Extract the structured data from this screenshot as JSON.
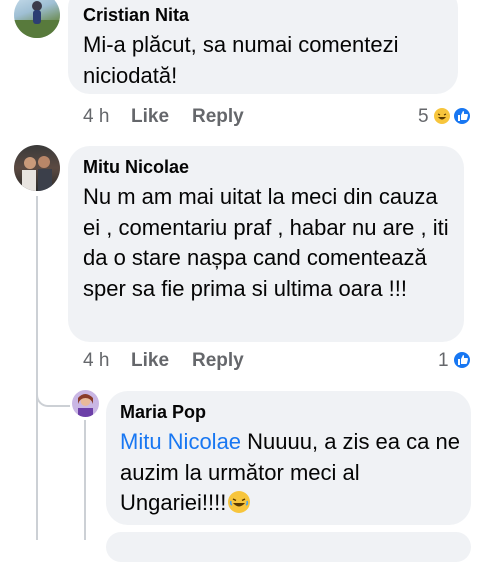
{
  "comments": [
    {
      "author": "Cristian Nita",
      "text": "Mi-a plăcut, sa numai comentezi niciodată!",
      "time": "4 h",
      "like_label": "Like",
      "reply_label": "Reply",
      "reaction_count": "5",
      "reactions": [
        "laugh-emoji-icon",
        "like-icon"
      ]
    },
    {
      "author": "Mitu Nicolae",
      "text": "Nu m am mai uitat la meci din cauza ei , comentariu praf , habar nu are , iti da o stare nașpa cand comentează sper sa fie prima si ultima oara !!!",
      "time": "4 h",
      "like_label": "Like",
      "reply_label": "Reply",
      "reaction_count": "1",
      "reactions": [
        "like-icon"
      ]
    }
  ],
  "reply": {
    "author": "Maria Pop",
    "mention": "Mitu Nicolae",
    "text": " Nuuuu, a zis ea ca ne auzim la următor meci al Ungariei!!!!",
    "emoji": "laugh-emoji-icon"
  },
  "colors": {
    "bubble": "#f0f2f5",
    "mention": "#1877f2",
    "like_blue": "#1877f2",
    "meta_gray": "#65676b"
  }
}
